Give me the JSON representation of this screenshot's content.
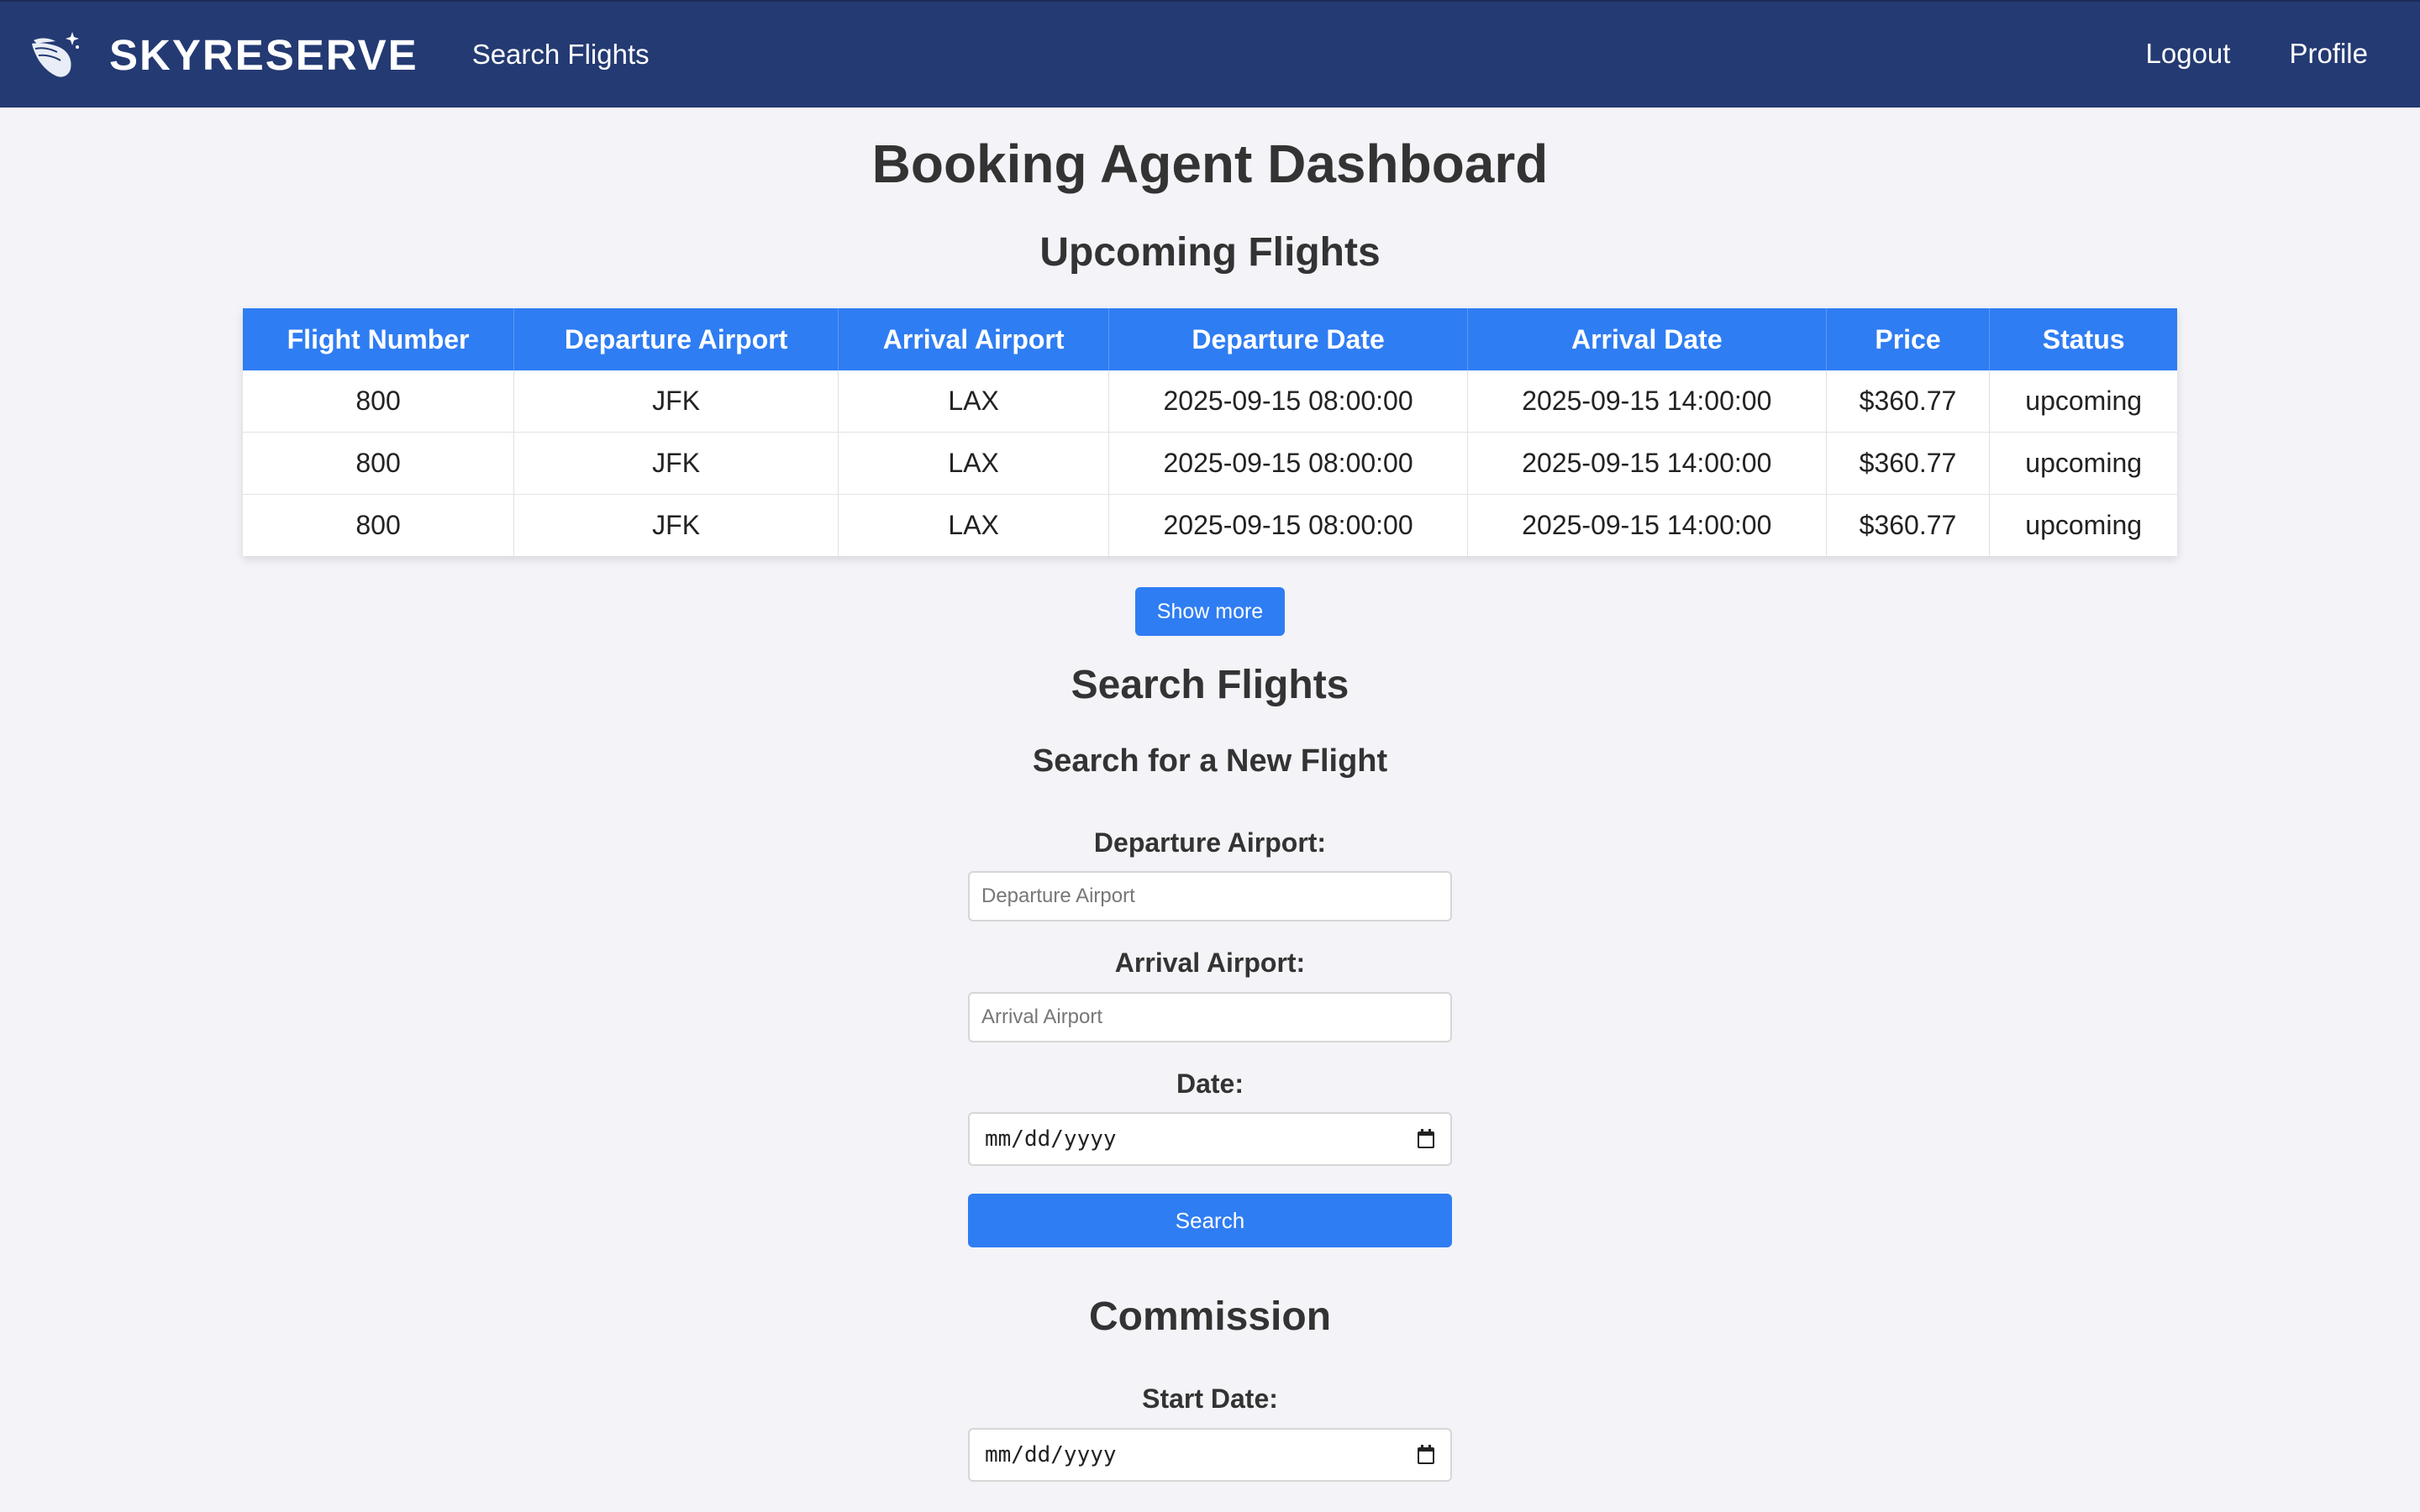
{
  "nav": {
    "brand": "SKYRESERVE",
    "search_link": "Search Flights",
    "logout": "Logout",
    "profile": "Profile"
  },
  "page_title": "Booking Agent Dashboard",
  "upcoming": {
    "title": "Upcoming Flights",
    "columns": [
      "Flight Number",
      "Departure Airport",
      "Arrival Airport",
      "Departure Date",
      "Arrival Date",
      "Price",
      "Status"
    ],
    "rows": [
      [
        "800",
        "JFK",
        "LAX",
        "2025-09-15 08:00:00",
        "2025-09-15 14:00:00",
        "$360.77",
        "upcoming"
      ],
      [
        "800",
        "JFK",
        "LAX",
        "2025-09-15 08:00:00",
        "2025-09-15 14:00:00",
        "$360.77",
        "upcoming"
      ],
      [
        "800",
        "JFK",
        "LAX",
        "2025-09-15 08:00:00",
        "2025-09-15 14:00:00",
        "$360.77",
        "upcoming"
      ]
    ],
    "show_more": "Show more"
  },
  "search": {
    "title": "Search Flights",
    "subtitle": "Search for a New Flight",
    "departure_label": "Departure Airport:",
    "departure_placeholder": "Departure Airport",
    "arrival_label": "Arrival Airport:",
    "arrival_placeholder": "Arrival Airport",
    "date_label": "Date:",
    "date_placeholder": "mm/dd/yyyy",
    "button": "Search"
  },
  "commission": {
    "title": "Commission",
    "start_label": "Start Date:",
    "start_placeholder": "mm/dd/yyyy"
  },
  "colors": {
    "navbar": "#243a73",
    "accent": "#2f7df3",
    "background": "#f3f3f8"
  }
}
